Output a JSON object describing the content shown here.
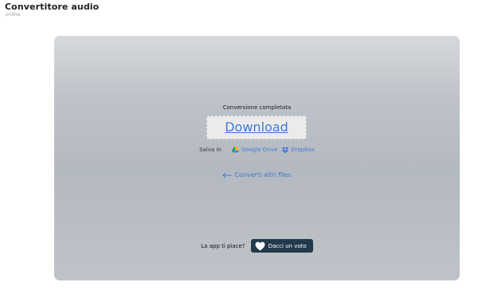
{
  "header": {
    "title": "Convertitore audio",
    "subtitle": "online"
  },
  "result": {
    "status": "Conversione completata",
    "download_label": "Download"
  },
  "save": {
    "label": "Salva in",
    "google_drive": "Google Drive",
    "dropbox": "Dropbox"
  },
  "convert_more": {
    "label": "Converti altri files",
    "icon": "arrow-left-icon"
  },
  "rating": {
    "question": "La app ti piace?",
    "button_label": "Dacci un voto",
    "icon": "heart-icon"
  },
  "colors": {
    "link": "#3f7bd0",
    "rate_button": "#23394c",
    "panel_top": "#d6d8dc",
    "panel_mid": "#b4b9c1"
  }
}
